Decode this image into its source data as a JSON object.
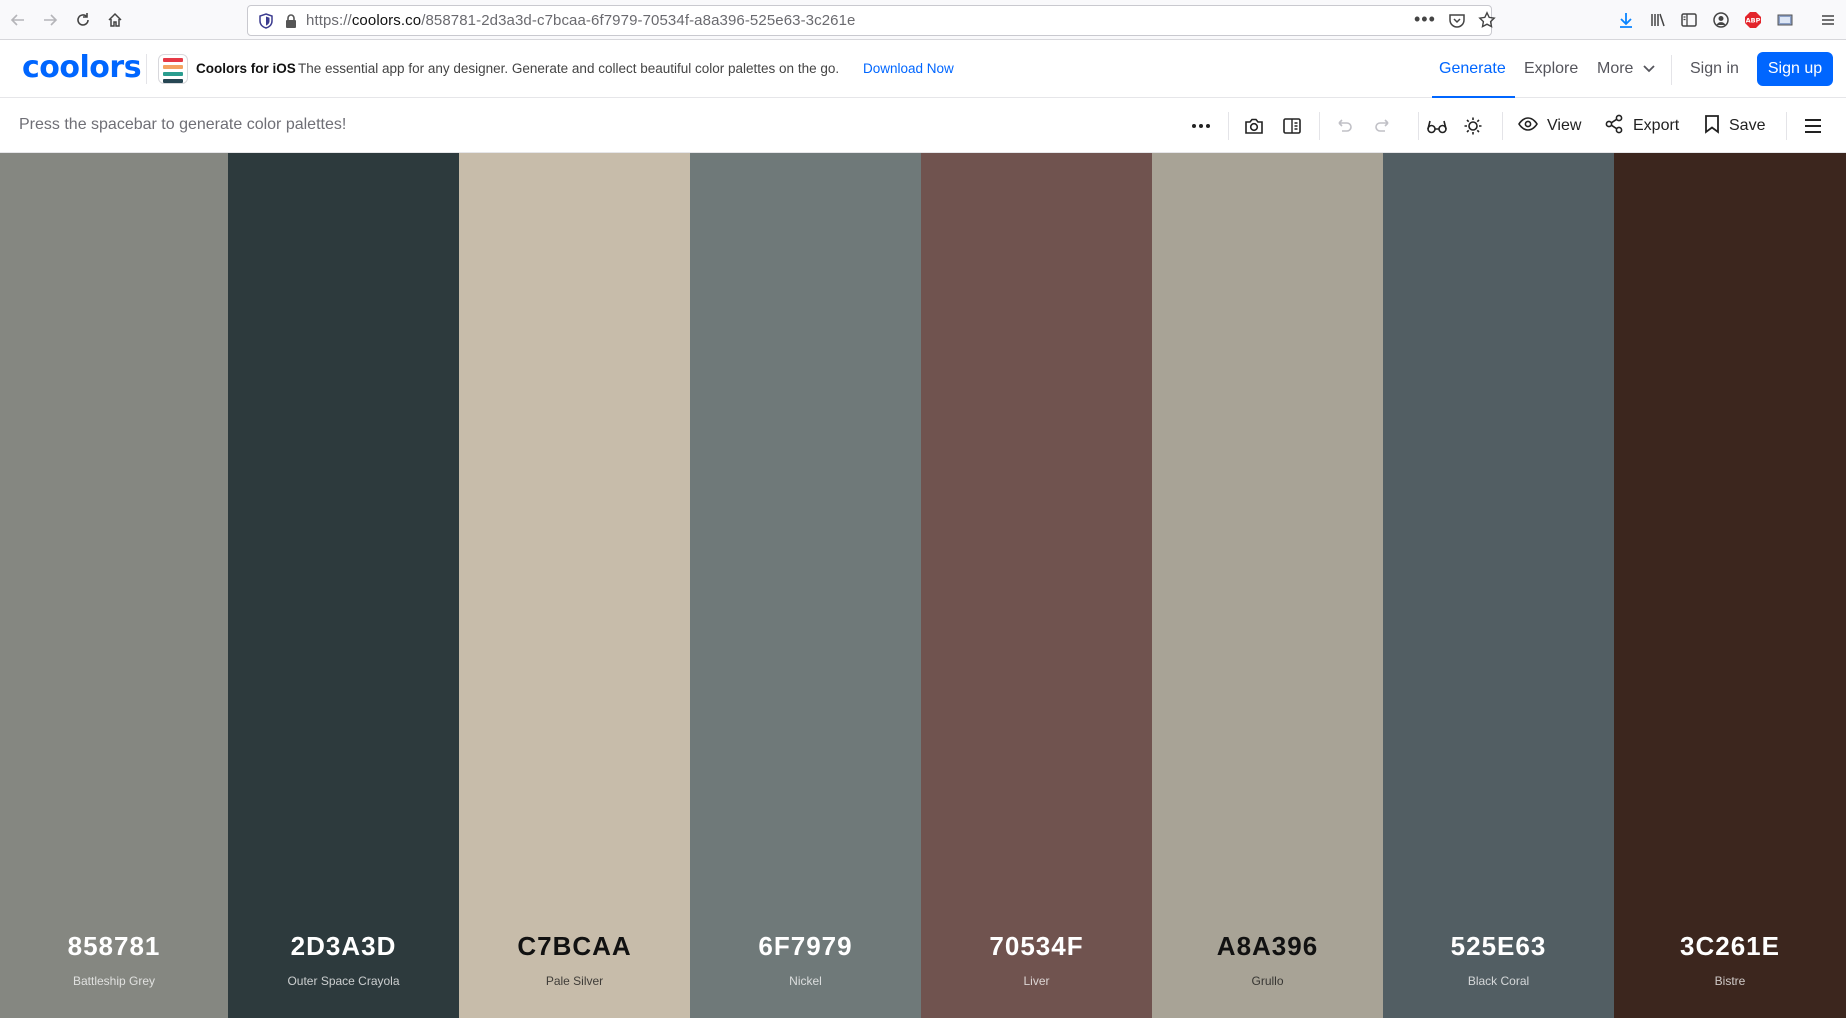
{
  "browser": {
    "url_prefix": "https://",
    "url_host": "coolors.co",
    "url_path": "/858781-2d3a3d-c7bcaa-6f7979-70534f-a8a396-525e63-3c261e",
    "icons": [
      "back-arrow-icon",
      "forward-arrow-icon",
      "reload-icon",
      "home-icon",
      "shield-icon",
      "lock-icon",
      "page-actions-icon",
      "pocket-icon",
      "bookmark-star-icon",
      "download-icon",
      "library-icon",
      "sidebar-icon",
      "account-icon",
      "adblock-icon",
      "screen-icon",
      "menu-icon"
    ],
    "adblock_label": "ABP"
  },
  "header": {
    "logo": "coolors",
    "promo_title": "Coolors for iOS",
    "promo_text": "The essential app for any designer. Generate and collect beautiful color palettes on the go.",
    "promo_link": "Download Now",
    "nav": {
      "generate": "Generate",
      "explore": "Explore",
      "more": "More",
      "signin": "Sign in",
      "signup": "Sign up"
    },
    "accent_color": "#0066ff"
  },
  "toolbar": {
    "hint": "Press the spacebar to generate color palettes!",
    "view": "View",
    "export": "Export",
    "save": "Save"
  },
  "palette": {
    "colors": [
      {
        "hex": "858781",
        "name": "Battleship Grey",
        "bg": "#858781",
        "fg": "#ffffff"
      },
      {
        "hex": "2D3A3D",
        "name": "Outer Space Crayola",
        "bg": "#2d3a3d",
        "fg": "#ffffff"
      },
      {
        "hex": "C7BCAA",
        "name": "Pale Silver",
        "bg": "#c7bcaa",
        "fg": "#111111"
      },
      {
        "hex": "6F7979",
        "name": "Nickel",
        "bg": "#6f7979",
        "fg": "#ffffff"
      },
      {
        "hex": "70534F",
        "name": "Liver",
        "bg": "#70534f",
        "fg": "#ffffff"
      },
      {
        "hex": "A8A396",
        "name": "Grullo",
        "bg": "#a8a396",
        "fg": "#111111"
      },
      {
        "hex": "525E63",
        "name": "Black Coral",
        "bg": "#525e63",
        "fg": "#ffffff"
      },
      {
        "hex": "3C261E",
        "name": "Bistre",
        "bg": "#3c261e",
        "fg": "#ffffff"
      }
    ]
  }
}
